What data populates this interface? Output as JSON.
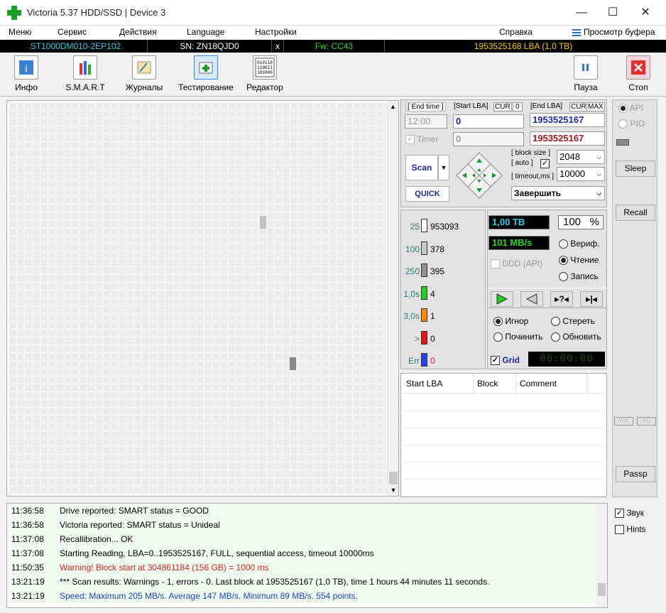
{
  "window": {
    "title": "Victoria 5.37 HDD/SSD | Device 3",
    "minimize": "—",
    "maximize": "☐",
    "close": "✕"
  },
  "menu": {
    "items": [
      "Меню",
      "Сервис",
      "Действия",
      "Language",
      "Настройки"
    ],
    "help": "Справка",
    "buffer": "Просмотр буфера"
  },
  "drive": {
    "model": "ST1000DM010-2EP102",
    "serial": "SN: ZN18QJD0",
    "x": "x",
    "fw": "Fw: CC43",
    "lba": "1953525168 LBA (1,0 TB)"
  },
  "toolbar": {
    "items": [
      {
        "label": "Инфо",
        "icon": "info-icon"
      },
      {
        "label": "S.M.A.R.T",
        "icon": "smart-icon"
      },
      {
        "label": "Журналы",
        "icon": "journal-icon"
      },
      {
        "label": "Тестирование",
        "icon": "test-icon"
      },
      {
        "label": "Редактор",
        "icon": "editor-icon"
      }
    ],
    "pause": "Пауза",
    "stop": "Стоп"
  },
  "scan": {
    "end_time_label": "[ End time ]",
    "start_lba_label": "[Start LBA]",
    "cur": "CUR",
    "cur_val": "0",
    "end_lba_label": "[End LBA]",
    "cur2": "CUR",
    "max": "MAX",
    "end_time": "12:00",
    "start_lba": "0",
    "end_lba": "1953525167",
    "timer_label": "Timer",
    "timer_value": "0",
    "end_lba2": "1953525167",
    "scan_button": "Scan",
    "quick_button": "QUICK",
    "block_size_label": "[ block size ]",
    "auto_label": "[ auto ]",
    "timeout_label": "[ timeout,ms ]",
    "block_size": "2048",
    "timeout": "10000",
    "action": "Завершить"
  },
  "stats": {
    "rows": [
      {
        "th": "25",
        "count": "953093",
        "color": "#ffffff"
      },
      {
        "th": "100",
        "count": "378",
        "color": "#c8c8c8"
      },
      {
        "th": "250",
        "count": "395",
        "color": "#909090"
      },
      {
        "th": "1,0s",
        "count": "4",
        "color": "#22cc22"
      },
      {
        "th": "3,0s",
        "count": "1",
        "color": "#ff8800"
      },
      {
        "th": ">",
        "count": "0",
        "color": "#ee1111"
      },
      {
        "th": "Err",
        "count": "0",
        "color": "#2244ee"
      }
    ]
  },
  "progress": {
    "size": "1,00 TB",
    "percent": "100",
    "pct_sign": "%",
    "speed": "101 MB/s",
    "ddd": "DDD (API)",
    "verify": "Вериф.",
    "read": "Чтение",
    "write": "Запись",
    "ignore": "Игнор",
    "erase": "Стереть",
    "repair": "Починить",
    "refresh": "Обновить",
    "grid": "Grid",
    "timer": "00:00:00"
  },
  "table": {
    "headers": [
      "Start LBA",
      "Block",
      "Comment"
    ]
  },
  "side": {
    "api": "API",
    "pio": "PIO",
    "sleep": "Sleep",
    "recall": "Recall",
    "wr": "WR",
    "rd": "RD",
    "passp": "Passp",
    "sound": "Звук",
    "hints": "Hints"
  },
  "log": [
    {
      "time": "11:36:58",
      "text": "Drive reported: SMART status = GOOD",
      "color": "#000000"
    },
    {
      "time": "11:36:58",
      "text": "Victoria reported: SMART status = Unideal",
      "color": "#000000"
    },
    {
      "time": "11:37:08",
      "text": "Recallibration... OK",
      "color": "#000000"
    },
    {
      "time": "11:37:08",
      "text": "Starting Reading, LBA=0..1953525167, FULL, sequential access, timeout 10000ms",
      "color": "#000000"
    },
    {
      "time": "11:50:35",
      "text": "Warning! Block start at 304861184 (156 GB)  = 1000 ms",
      "color": "#e02020"
    },
    {
      "time": "13:21:19",
      "text": "*** Scan results: Warnings - 1, errors - 0. Last block at 1953525167 (1,0 TB), time 1 hours 44 minutes 11 seconds.",
      "color": "#000000"
    },
    {
      "time": "13:21:19",
      "text": "Speed: Maximum 205 MB/s. Average 147 MB/s. Minimum 89 MB/s. 554 points.",
      "color": "#1a3fd0"
    }
  ]
}
